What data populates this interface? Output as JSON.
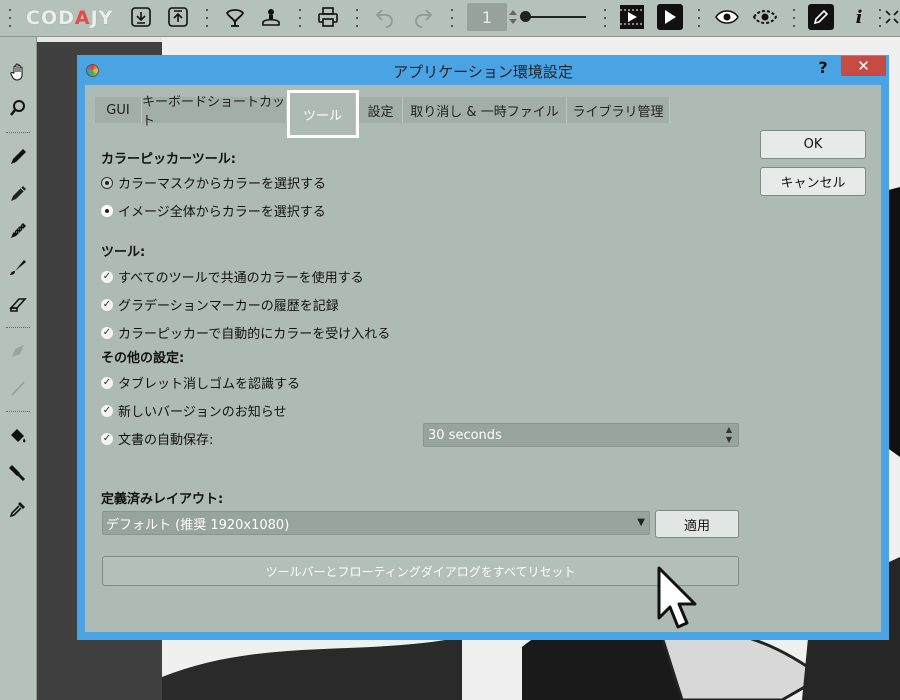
{
  "app": {
    "logo_part1": "COD",
    "logo_part2": "JY",
    "frame_number": "1"
  },
  "toolbar_icons": [
    "download-icon",
    "upload-icon",
    "onion-skin-icon",
    "stamp-icon",
    "print-icon",
    "undo-icon",
    "redo-icon",
    "frame-stepper-icon",
    "play-all-icon",
    "play-icon",
    "eye-icon",
    "eye-dashed-icon",
    "pencil-icon",
    "info-icon",
    "fullscreen-icon"
  ],
  "left_icons": [
    "hand-icon",
    "zoom-icon",
    "pen-icon",
    "pencil-icon",
    "spray-icon",
    "brush-icon",
    "eraser-icon",
    "disabled-tool-icon",
    "disabled-tool-2-icon",
    "fill-icon",
    "stamp-tool-icon",
    "eyedropper-icon"
  ],
  "dialog": {
    "title": "アプリケーション環境設定",
    "help": "?",
    "close": "✕",
    "tabs": [
      {
        "label": "GUI"
      },
      {
        "label": "キーボードショートカット"
      },
      {
        "label": "ツール"
      },
      {
        "label": "設定"
      },
      {
        "label": "取り消し & 一時ファイル"
      },
      {
        "label": "ライブラリ管理"
      }
    ],
    "ok": "OK",
    "cancel": "キャンセル",
    "color_picker": {
      "title": "カラーピッカーツール:",
      "option1": "カラーマスクからカラーを選択する",
      "option2": "イメージ全体からカラーを選択する"
    },
    "tools": {
      "title": "ツール:",
      "option1": "すべてのツールで共通のカラーを使用する",
      "option2": "グラデーションマーカーの履歴を記録",
      "option3": "カラーピッカーで自動的にカラーを受け入れる"
    },
    "other": {
      "title": "その他の設定:",
      "option1": "タブレット消しゴムを認識する",
      "option2": "新しいバージョンのお知らせ",
      "option3": "文書の自動保存:",
      "autosave_value": "30 seconds"
    },
    "layout": {
      "title": "定義済みレイアウト:",
      "selected": "デフォルト (推奨 1920x1080)",
      "apply": "適用",
      "reset": "ツールバーとフローティングダイアログをすべてリセット"
    }
  },
  "colors": {
    "dialog_border": "#4aa3e2",
    "body": "#aebbb5",
    "close": "#c74b43"
  }
}
